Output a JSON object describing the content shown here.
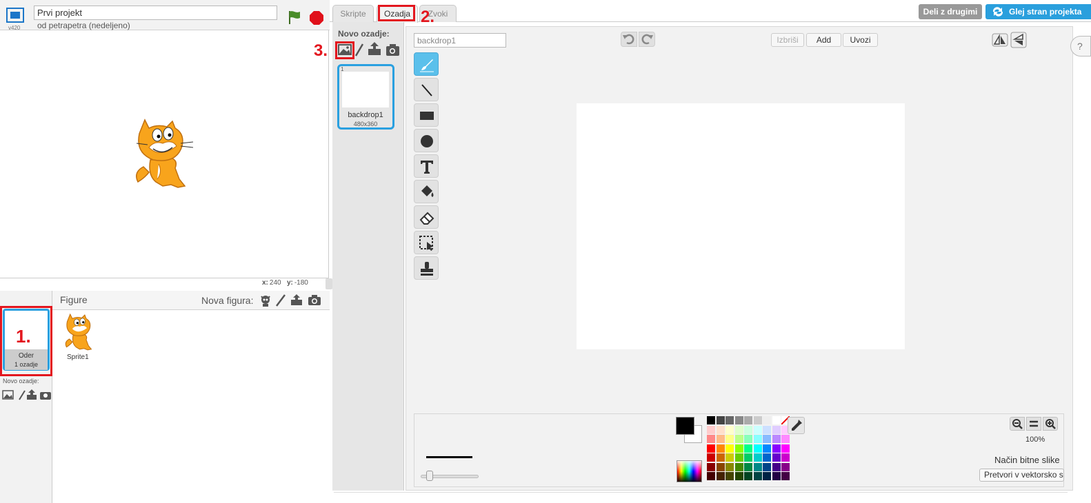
{
  "stage_header": {
    "version": "v420",
    "project_title": "Prvi projekt",
    "owner": "od petrapetra (nedeljeno)"
  },
  "stage": {
    "x_label": "x:",
    "x_value": "240",
    "y_label": "y:",
    "y_value": "-180"
  },
  "sprites": {
    "title": "Figure",
    "new_sprite_label": "Nova figura:",
    "stage_thumb_name": "Oder",
    "stage_thumb_count": "1 ozadje",
    "new_backdrop_label": "Novo ozadje:",
    "items": [
      {
        "name": "Sprite1"
      }
    ]
  },
  "tabs": [
    {
      "label": "Skripte"
    },
    {
      "label": "Ozadja"
    },
    {
      "label": "Zvoki"
    }
  ],
  "header_buttons": {
    "share": "Deli z drugimi",
    "project_page": "Glej stran projekta"
  },
  "annotations": {
    "one": "1.",
    "two": "2.",
    "three": "3."
  },
  "backdrops": {
    "title": "Novo ozadje:",
    "items": [
      {
        "number": "1",
        "name": "backdrop1",
        "size": "480x360"
      }
    ]
  },
  "editor": {
    "costume_name": "backdrop1",
    "clear": "Izbriši",
    "add": "Add",
    "import": "Uvozi",
    "zoom_level": "100%",
    "mode_label": "Način bitne slike",
    "convert_button": "Pretvori v vektorsko sliko"
  },
  "colors": {
    "accent_blue": "#2aa0e0",
    "annotation_red": "#e3161e",
    "primary": "#000000",
    "secondary": "#ffffff",
    "palette": [
      [
        "#000000",
        "#444444",
        "#666666",
        "#888888",
        "#aaaaaa",
        "#cccccc",
        "#eeeeee",
        "#ffffff",
        "transparent"
      ],
      [
        "#ffcccc",
        "#ffe0cc",
        "#ffffcc",
        "#e0ffcc",
        "#ccffe0",
        "#ccffff",
        "#cce0ff",
        "#e0ccff",
        "#ffccff"
      ],
      [
        "#ff8888",
        "#ffbb88",
        "#ffff88",
        "#bbff88",
        "#88ffbb",
        "#88ffff",
        "#88bbff",
        "#bb88ff",
        "#ff88ff"
      ],
      [
        "#ff0000",
        "#ff8800",
        "#ffff00",
        "#88ff00",
        "#00ff88",
        "#00ffff",
        "#0088ff",
        "#8800ff",
        "#ff00ff"
      ],
      [
        "#cc0000",
        "#cc6600",
        "#cccc00",
        "#66cc00",
        "#00cc66",
        "#00cccc",
        "#0066cc",
        "#6600cc",
        "#cc00cc"
      ],
      [
        "#880000",
        "#884400",
        "#888800",
        "#448800",
        "#008844",
        "#008888",
        "#004488",
        "#440088",
        "#880088"
      ],
      [
        "#440000",
        "#442200",
        "#444400",
        "#224400",
        "#004422",
        "#004444",
        "#002244",
        "#220044",
        "#440044"
      ]
    ]
  }
}
